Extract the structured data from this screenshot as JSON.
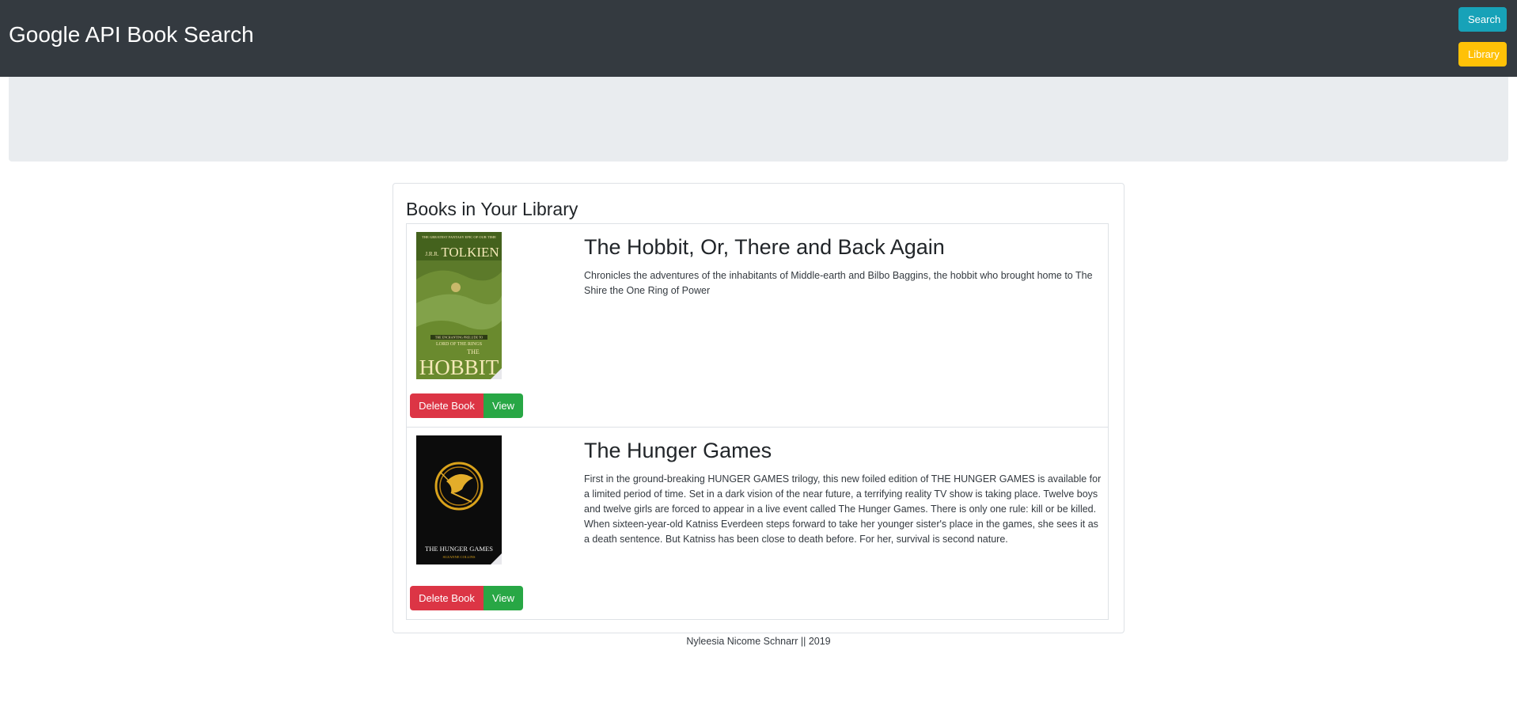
{
  "navbar": {
    "brand": "Google API Book Search",
    "search_label": "Search",
    "library_label": "Library"
  },
  "library": {
    "heading": "Books in Your Library",
    "books": [
      {
        "title": "The Hobbit, Or, There and Back Again",
        "description": "Chronicles the adventures of the inhabitants of Middle-earth and Bilbo Baggins, the hobbit who brought home to The Shire the One Ring of Power",
        "cover_text": {
          "tagline": "THE GREATEST FANTASY EPIC OF OUR TIME",
          "author_initials": "J.R.R.",
          "author": "TOLKIEN",
          "prelude": "THE ENCHANTING PRELUDE TO",
          "series": "LORD OF THE RINGS",
          "title_the": "THE",
          "title": "HOBBIT"
        },
        "delete_label": "Delete Book",
        "view_label": "View"
      },
      {
        "title": "The Hunger Games",
        "description": "First in the ground-breaking HUNGER GAMES trilogy, this new foiled edition of THE HUNGER GAMES is available for a limited period of time. Set in a dark vision of the near future, a terrifying reality TV show is taking place. Twelve boys and twelve girls are forced to appear in a live event called The Hunger Games. There is only one rule: kill or be killed. When sixteen-year-old Katniss Everdeen steps forward to take her younger sister's place in the games, she sees it as a death sentence. But Katniss has been close to death before. For her, survival is second nature.",
        "cover_text": {
          "title": "THE HUNGER GAMES",
          "author": "SUZANNE COLLINS"
        },
        "delete_label": "Delete Book",
        "view_label": "View"
      }
    ]
  },
  "footer": {
    "text": "Nyleesia Nicome Schnarr || 2019"
  }
}
